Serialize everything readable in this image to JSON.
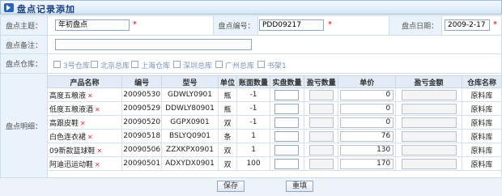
{
  "title": "盘点记录添加",
  "form": {
    "subject_label": "盘点主题：",
    "subject_value": "年初盘点",
    "number_label": "盘点编号：",
    "number_value": "PDD09217",
    "date_label": "盘点日期：",
    "date_value": "2009-2-17",
    "remark_label": "盘点备注：",
    "remark_value": "",
    "warehouse_label": "盘点仓库：",
    "detail_label": "盘点明细：",
    "required_mark": "*"
  },
  "warehouses": [
    "3号仓库",
    "北京总库",
    "上海仓库",
    "深圳总库",
    "广州总库",
    "书架1"
  ],
  "table": {
    "headers": [
      "产品名称",
      "编号",
      "型号",
      "单位",
      "账面数量",
      "实盘数量",
      "盈亏数量",
      "单价",
      "盈亏金额",
      "仓库名称"
    ],
    "rows": [
      {
        "name": "高度五粮液",
        "code": "20090530",
        "model": "GDWLY0901",
        "unit": "瓶",
        "book_qty": "-1",
        "price": "0",
        "warehouse": "原料库"
      },
      {
        "name": "低度五粮液酒",
        "code": "20090529",
        "model": "DDWLY80901",
        "unit": "瓶",
        "book_qty": "-1",
        "price": "0",
        "warehouse": "原料库"
      },
      {
        "name": "高跟皮鞋",
        "code": "20090520",
        "model": "GGPX0901",
        "unit": "双",
        "book_qty": "-1",
        "price": "0",
        "warehouse": "原料库"
      },
      {
        "name": "白色连衣裙",
        "code": "20090518",
        "model": "BSLYQ0901",
        "unit": "条",
        "book_qty": "1",
        "price": "76",
        "warehouse": "原料库"
      },
      {
        "name": "09新款篮球鞋",
        "code": "20090506",
        "model": "ZZXKPX0901",
        "unit": "双",
        "book_qty": "1",
        "price": "130",
        "warehouse": "原料库"
      },
      {
        "name": "阿迪迅运动鞋",
        "code": "20090501",
        "model": "ADXYDX0901",
        "unit": "双",
        "book_qty": "100",
        "price": "170",
        "warehouse": "原料库"
      }
    ],
    "remove_glyph": "✕"
  },
  "buttons": {
    "save": "保存",
    "reset": "重填"
  },
  "colors": {
    "title": "#1c3f86",
    "label_bg": "#eaf2fb",
    "required": "#ee0000",
    "header_bg": "#e2ebf6"
  }
}
